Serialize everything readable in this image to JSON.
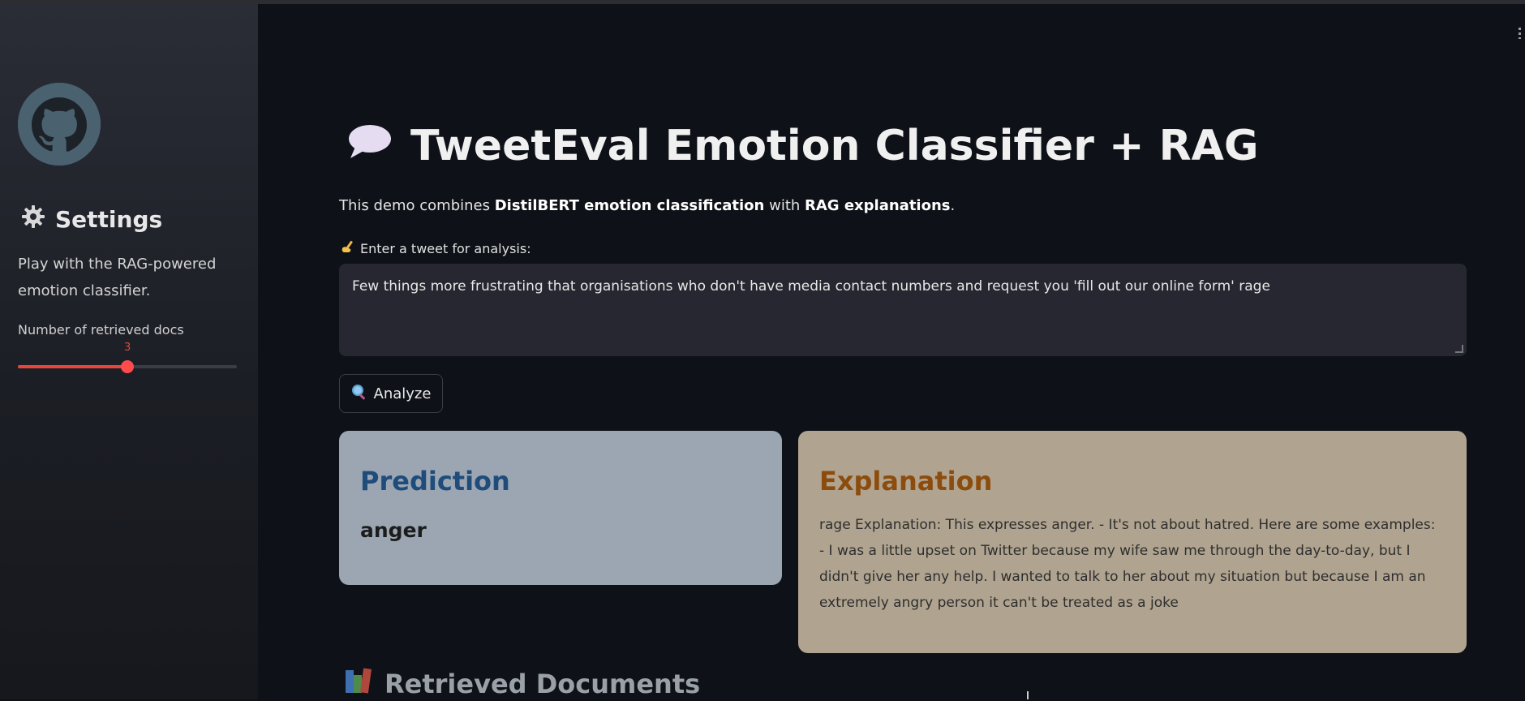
{
  "sidebar": {
    "title": "Settings",
    "description": "Play with the RAG-powered emotion classifier.",
    "slider": {
      "label": "Number of retrieved docs",
      "value": "3",
      "fraction": 0.5
    }
  },
  "main": {
    "title": "TweetEval Emotion Classifier + RAG",
    "intro": {
      "prefix": "This demo combines ",
      "bold1": "DistilBERT emotion classification",
      "middle": " with ",
      "bold2": "RAG explanations",
      "suffix": "."
    },
    "input_label": "Enter a tweet for analysis:",
    "input_value": "Few things more frustrating that organisations who don't have media contact numbers and request you 'fill out our online form' rage",
    "analyze_label": "Analyze",
    "prediction": {
      "title": "Prediction",
      "value": "anger"
    },
    "explanation": {
      "title": "Explanation",
      "text": "rage Explanation: This expresses anger. - It's not about hatred. Here are some examples: - I was a little upset on Twitter because my wife saw me through the day-to-day, but I didn't give her any help. I wanted to talk to her about my situation but because I am an extremely angry person it can't be treated as a joke"
    },
    "section_title": "Retrieved Documents"
  },
  "colors": {
    "accent": "#ff4b4b",
    "prediction_title": "#1f4c7a",
    "explanation_title": "#8b4c0d"
  },
  "icons": [
    "github-logo",
    "gear-icon",
    "speech-bubble-icon",
    "writing-hand-icon",
    "magnifier-icon",
    "books-icon"
  ]
}
